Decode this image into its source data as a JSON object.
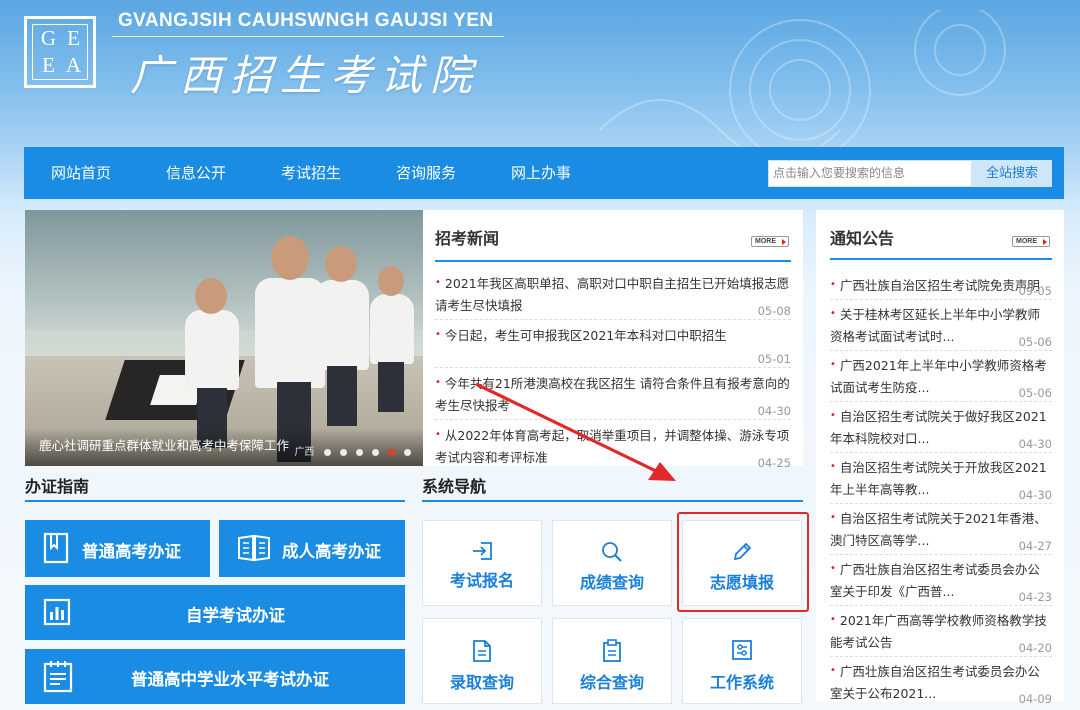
{
  "header": {
    "latin_name": "GVANGJSIH CAUHSWNGH GAUJSI YEN",
    "cn_name": "广西招生考试院",
    "logo_letters": [
      "G",
      "E",
      "E",
      "A"
    ]
  },
  "nav": {
    "items": [
      "网站首页",
      "信息公开",
      "考试招生",
      "咨询服务",
      "网上办事"
    ],
    "search_placeholder": "点击输入您要搜索的信息",
    "search_button": "全站搜索"
  },
  "slideshow": {
    "caption": "鹿心社调研重点群体就业和高考中考保障工作",
    "watermark": "广西",
    "active_dot": 5
  },
  "news": {
    "title": "招考新闻",
    "more": "MORE",
    "items": [
      {
        "text": "2021年我区高职单招、高职对口中职自主招生已开始填报志愿 请考生尽快填报",
        "date": "05-08"
      },
      {
        "text": "今日起，考生可申报我区2021年本科对口中职招生",
        "date": "05-01"
      },
      {
        "text": "今年共有21所港澳高校在我区招生 请符合条件且有报考意向的考生尽快报考",
        "date": "04-30"
      },
      {
        "text": "从2022年体育高考起，取消举重项目，并调整体操、游泳专项考试内容和考评标准",
        "date": "04-25"
      }
    ]
  },
  "notice": {
    "title": "通知公告",
    "more": "MORE",
    "items": [
      {
        "text": "广西壮族自治区招生考试院免责声明",
        "date": "09-05"
      },
      {
        "text": "关于桂林考区延长上半年中小学教师资格考试面试考试时...",
        "date": "05-06"
      },
      {
        "text": "广西2021年上半年中小学教师资格考试面试考生防疫...",
        "date": "05-06"
      },
      {
        "text": "自治区招生考试院关于做好我区2021年本科院校对口...",
        "date": "04-30"
      },
      {
        "text": "自治区招生考试院关于开放我区2021年上半年高等教...",
        "date": "04-30"
      },
      {
        "text": "自治区招生考试院关于2021年香港、澳门特区高等学...",
        "date": "04-27"
      },
      {
        "text": "广西壮族自治区招生考试委员会办公室关于印发《广西普...",
        "date": "04-23"
      },
      {
        "text": "2021年广西高等学校教师资格教学技能考试公告",
        "date": "04-20"
      },
      {
        "text": "广西壮族自治区招生考试委员会办公室关于公布2021...",
        "date": "04-09"
      }
    ]
  },
  "guide": {
    "title": "办证指南",
    "buttons": [
      "普通高考办证",
      "成人高考办证",
      "自学考试办证",
      "普通高中学业水平考试办证"
    ]
  },
  "system": {
    "title": "系统导航",
    "tiles": [
      "考试报名",
      "成绩查询",
      "志愿填报",
      "录取查询",
      "综合查询",
      "工作系统"
    ]
  },
  "colors": {
    "primary": "#1a8ce3",
    "highlight": "#e02a2a",
    "bullet": "#d2281c"
  }
}
